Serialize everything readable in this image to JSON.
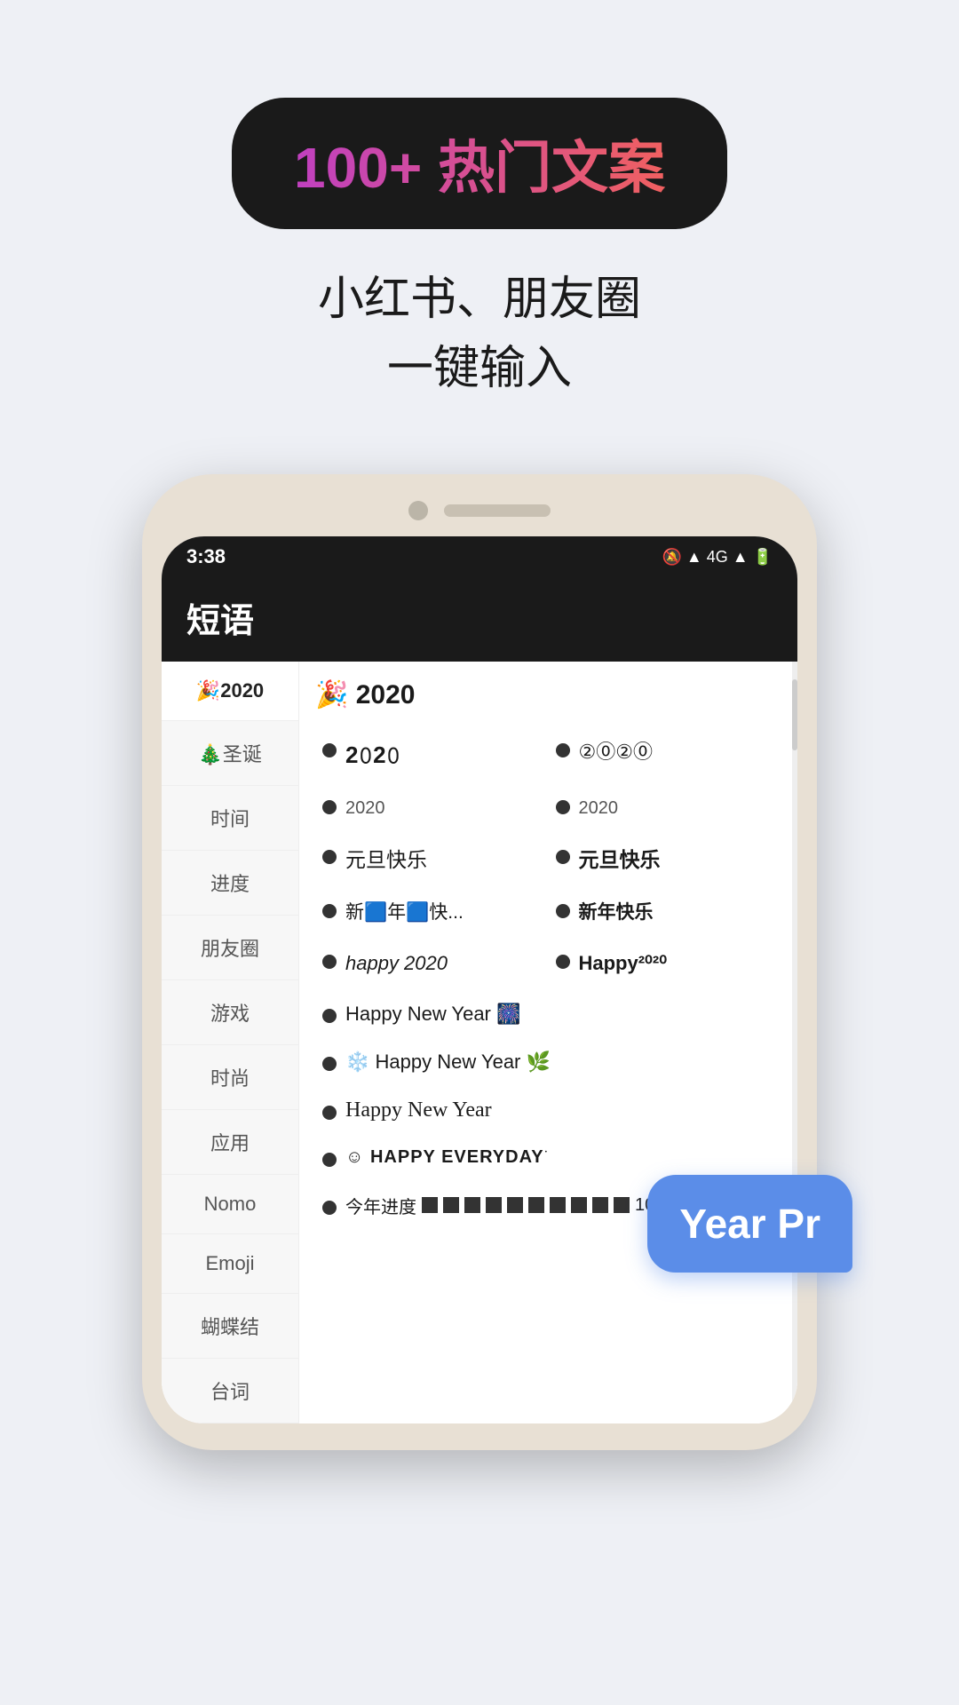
{
  "badge": {
    "text": "100+ 热门文案"
  },
  "subtitle": {
    "line1": "小红书、朋友圈",
    "line2": "一键输入"
  },
  "status_bar": {
    "time": "3:38",
    "icons": "🔕 📶 4G 1X 📶 🔋"
  },
  "app_header": {
    "title": "短语"
  },
  "sidebar": {
    "items": [
      {
        "label": "🎉2020",
        "active": true
      },
      {
        "label": "🎄圣诞"
      },
      {
        "label": "时间"
      },
      {
        "label": "进度"
      },
      {
        "label": "朋友圈"
      },
      {
        "label": "游戏"
      },
      {
        "label": "时尚"
      },
      {
        "label": "应用"
      },
      {
        "label": "Nomo"
      },
      {
        "label": "Emoji"
      },
      {
        "label": "蝴蝶结"
      },
      {
        "label": "台词"
      }
    ]
  },
  "main": {
    "section_title": "🎉 2020",
    "items": [
      {
        "text": "2𝟶2𝟶",
        "style": "styled"
      },
      {
        "text": "②⓪②⓪",
        "style": "circle"
      },
      {
        "text": "2020",
        "style": "small"
      },
      {
        "text": "2020",
        "style": "small"
      },
      {
        "text": "元旦快乐",
        "style": "normal"
      },
      {
        "text": "元旦快乐",
        "style": "normal"
      },
      {
        "text": "新🟦年🟦快...",
        "style": "normal"
      },
      {
        "text": "新年快乐",
        "style": "normal"
      },
      {
        "text": "happy 2020",
        "style": "italic"
      },
      {
        "text": "Happy²⁰²⁰",
        "style": "bold"
      }
    ],
    "full_items": [
      {
        "text": "Happy New Year 🎆",
        "style": "normal"
      },
      {
        "text": "❄️ Happy New Year 🌿",
        "style": "normal"
      },
      {
        "text": "Happy New Year",
        "style": "script"
      },
      {
        "text": "☺ HAPPY EVERYDAY͘",
        "style": "everyday"
      },
      {
        "text": "今年进度■■■■■■■■■■ 100%",
        "style": "progress"
      }
    ]
  },
  "tooltip": {
    "text": "Year Pr"
  }
}
